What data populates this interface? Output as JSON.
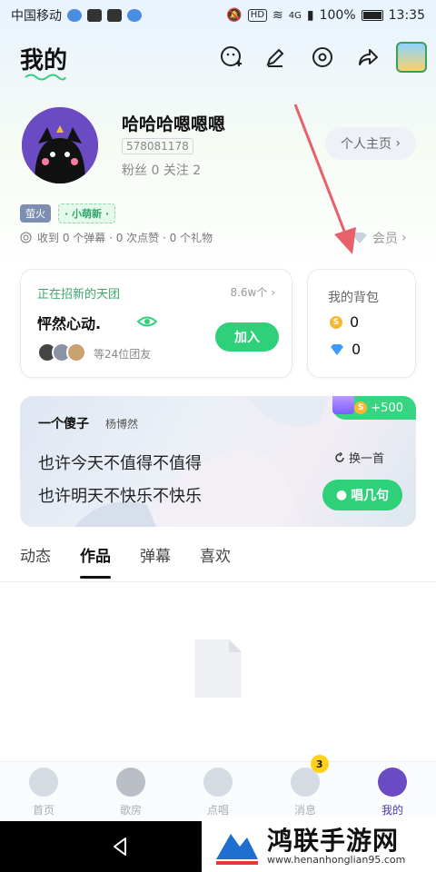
{
  "status_bar": {
    "carrier": "中国移动",
    "network": "4G",
    "battery": "100%",
    "time": "13:35"
  },
  "header": {
    "title": "我的",
    "icons": [
      "face-add-icon",
      "pen-icon",
      "settings-icon",
      "share-icon",
      "treasure-icon"
    ]
  },
  "profile": {
    "username": "哈哈哈嗯嗯嗯",
    "uid": "578081178",
    "fans": "粉丝 0",
    "following": "关注 2",
    "homepage_button": "个人主页",
    "tag_firefly": "萤火",
    "tag_new": "· 小萌新 ·",
    "received": "收到 0 个弹幕 · 0 次点赞 · 0 个礼物",
    "vip": "会员"
  },
  "group_card": {
    "recruit": "正在招新的天团",
    "count": "8.6w个",
    "name": "怦然心动.",
    "members": "等24位团友",
    "join_button": "加入"
  },
  "bag_card": {
    "title": "我的背包",
    "coins": "0",
    "diamonds": "0"
  },
  "song_card": {
    "who": "一个傻子",
    "singer": "杨博然",
    "lyric_line1": "也许今天不值得不值得",
    "lyric_line2": "也许明天不快乐不快乐",
    "reward": "+500",
    "change_button": "换一首",
    "sing_button": "唱几句"
  },
  "tabs": [
    {
      "label": "动态"
    },
    {
      "label": "作品"
    },
    {
      "label": "弹幕"
    },
    {
      "label": "喜欢"
    }
  ],
  "bottom_nav": [
    {
      "label": "首页"
    },
    {
      "label": "歌房"
    },
    {
      "label": "点唱"
    },
    {
      "label": "消息",
      "badge": "3"
    },
    {
      "label": "我的"
    }
  ],
  "watermark": {
    "title": "鸿联手游网",
    "url": "www.henanhonglian95.com"
  },
  "colors": {
    "accent_green": "#2fd07a",
    "annotation_arrow": "#e8606a",
    "nav_active": "#4a3aa8"
  }
}
